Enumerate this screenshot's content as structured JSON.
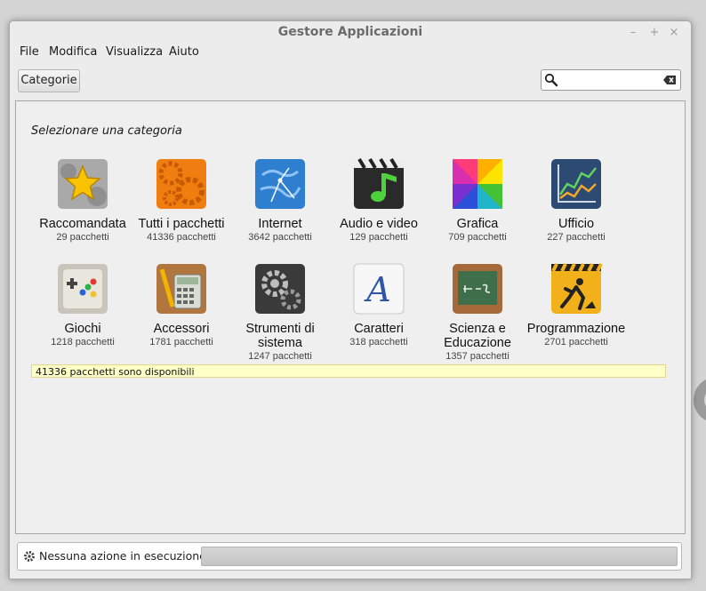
{
  "window": {
    "title": "Gestore Applicazioni"
  },
  "menu": [
    "File",
    "Modifica",
    "Visualizza",
    "Aiuto"
  ],
  "toolbar": {
    "categories_label": "Categorie"
  },
  "search": {
    "value": ""
  },
  "content": {
    "heading": "Selezionare una categoria",
    "categories": [
      {
        "name": "Raccomandata",
        "count": "29 pacchetti"
      },
      {
        "name": "Tutti i pacchetti",
        "count": "41336 pacchetti"
      },
      {
        "name": "Internet",
        "count": "3642 pacchetti"
      },
      {
        "name": "Audio e video",
        "count": "129 pacchetti"
      },
      {
        "name": "Grafica",
        "count": "709 pacchetti"
      },
      {
        "name": "Ufficio",
        "count": "227 pacchetti"
      },
      {
        "name": "Giochi",
        "count": "1218 pacchetti"
      },
      {
        "name": "Accessori",
        "count": "1781 pacchetti"
      },
      {
        "name": "Strumenti di sistema",
        "count": "1247 pacchetti"
      },
      {
        "name": "Caratteri",
        "count": "318 pacchetti"
      },
      {
        "name": "Scienza e Educazione",
        "count": "1357 pacchetti"
      },
      {
        "name": "Programmazione",
        "count": "2701 pacchetti"
      }
    ],
    "status": "41336 pacchetti sono disponibili"
  },
  "statusbar": {
    "text": "Nessuna azione in esecuzione"
  }
}
